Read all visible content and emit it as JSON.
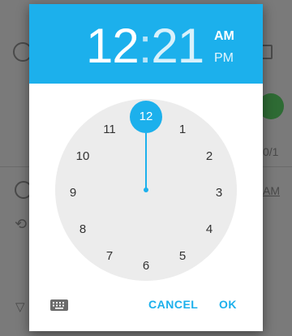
{
  "background_app": {
    "date_fragment": "0/1",
    "time_fragment": "AM"
  },
  "time_picker": {
    "hour": "12",
    "separator": ":",
    "minute": "21",
    "am_label": "AM",
    "pm_label": "PM",
    "selected_period": "AM",
    "selected_hour": "12",
    "dial_numbers": [
      "12",
      "1",
      "2",
      "3",
      "4",
      "5",
      "6",
      "7",
      "8",
      "9",
      "10",
      "11"
    ],
    "keyboard_icon": "keyboard-icon",
    "cancel_label": "CANCEL",
    "ok_label": "OK",
    "accent_color": "#1cb0ec"
  }
}
